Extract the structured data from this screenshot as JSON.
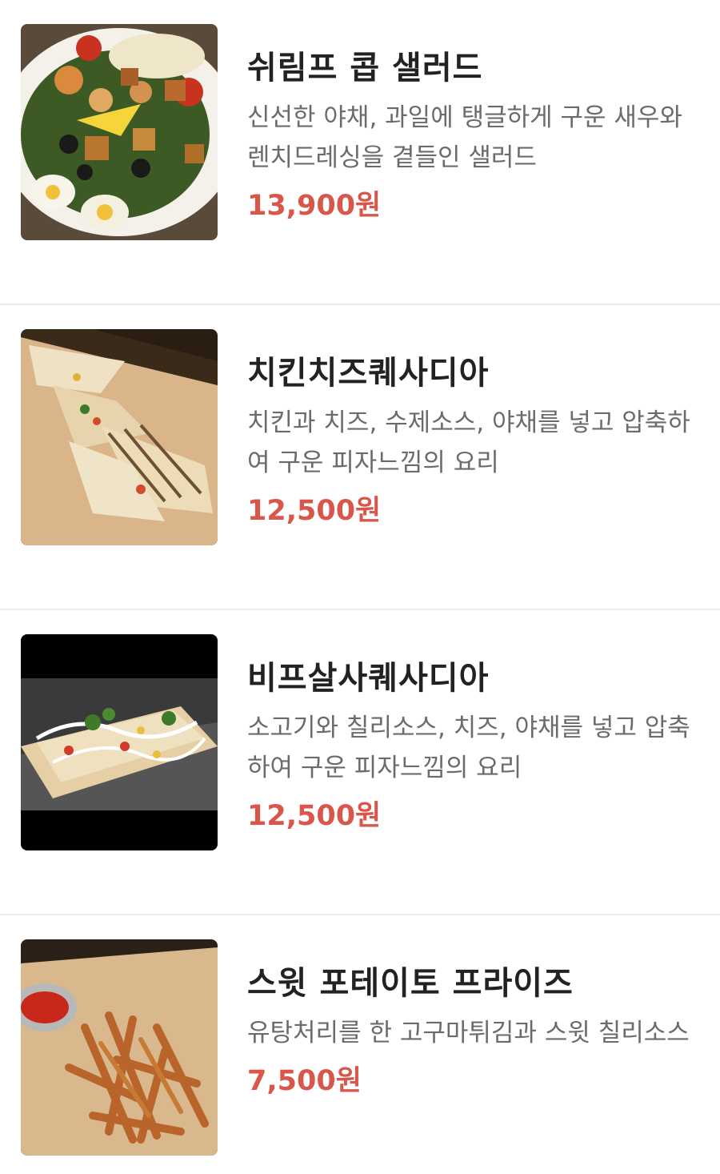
{
  "menu": {
    "items": [
      {
        "name": "쉬림프 콥 샐러드",
        "description": "신선한 야채, 과일에 탱글하게 구운 새우와 렌치드레싱을 곁들인 샐러드",
        "price": "13,900원",
        "photo_icon": "salad-photo"
      },
      {
        "name": "치킨치즈퀘사디아",
        "description": "치킨과 치즈, 수제소스, 야채를 넣고 압축하여 구운 피자느낌의 요리",
        "price": "12,500원",
        "photo_icon": "quesadilla-photo"
      },
      {
        "name": "비프살사퀘사디아",
        "description": "소고기와 칠리소스, 치즈, 야채를 넣고 압축하여 구운 피자느낌의 요리",
        "price": "12,500원",
        "photo_icon": "beef-quesadilla-photo"
      },
      {
        "name": "스윗 포테이토 프라이즈",
        "description": "유탕처리를 한 고구마튀김과 스윗 칠리소스",
        "price": "7,500원",
        "photo_icon": "fries-photo"
      }
    ],
    "colors": {
      "price": "#d9564b",
      "name": "#222222",
      "description": "#6b6b6b",
      "divider": "#ececec"
    }
  }
}
